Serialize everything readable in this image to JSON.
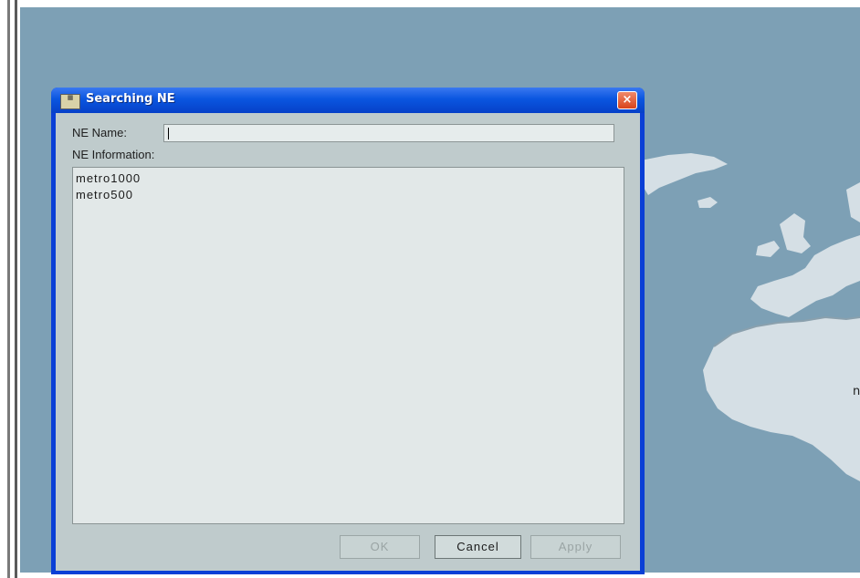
{
  "dialog": {
    "title": "Searching NE",
    "icon": "app-icon",
    "close": "×",
    "ne_name_label": "NE Name:",
    "ne_name_value": "",
    "ne_info_label": "NE Information:",
    "ne_items": [
      "metro1000",
      "metro500"
    ],
    "buttons": {
      "ok": "OK",
      "cancel": "Cancel",
      "apply": "Apply"
    }
  },
  "background": {
    "map_label": "n",
    "ocean_color": "#7da0b5",
    "land_color": "#d5dfe5"
  }
}
